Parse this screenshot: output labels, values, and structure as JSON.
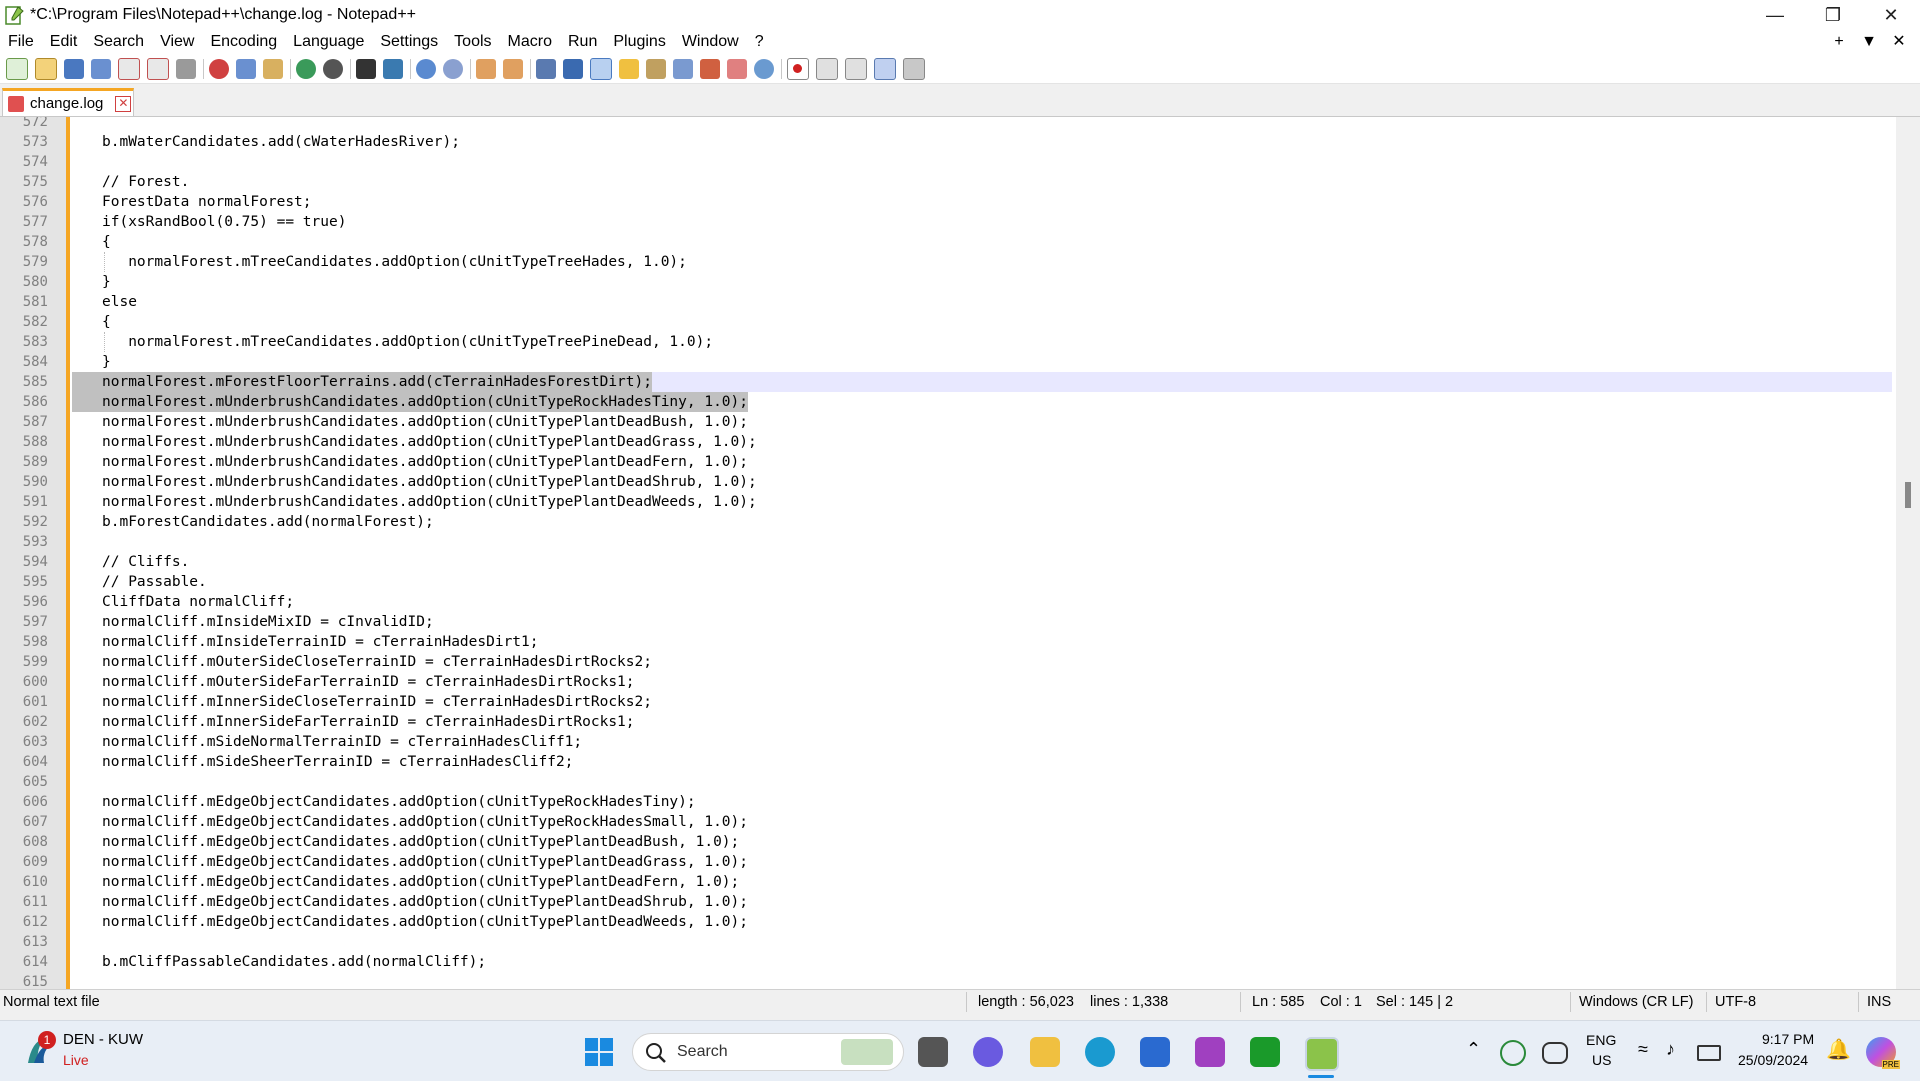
{
  "window": {
    "title": "*C:\\Program Files\\Notepad++\\change.log - Notepad++",
    "min_icon": "minimize-icon",
    "max_icon": "restore-icon",
    "close_icon": "close-icon"
  },
  "menu": {
    "items": [
      "File",
      "Edit",
      "Search",
      "View",
      "Encoding",
      "Language",
      "Settings",
      "Tools",
      "Macro",
      "Run",
      "Plugins",
      "Window",
      "?"
    ],
    "right": [
      "+",
      "▼",
      "✕"
    ]
  },
  "tab": {
    "label": "change.log",
    "close": "✕"
  },
  "editor": {
    "lines": [
      {
        "n": "572",
        "t": ""
      },
      {
        "n": "573",
        "t": "b.mWaterCandidates.add(cWaterHadesRiver);"
      },
      {
        "n": "574",
        "t": ""
      },
      {
        "n": "575",
        "t": "// Forest."
      },
      {
        "n": "576",
        "t": "ForestData normalForest;"
      },
      {
        "n": "577",
        "t": "if(xsRandBool(0.75) == true)"
      },
      {
        "n": "578",
        "t": "{"
      },
      {
        "n": "579",
        "t": "   normalForest.mTreeCandidates.addOption(cUnitTypeTreeHades, 1.0);"
      },
      {
        "n": "580",
        "t": "}"
      },
      {
        "n": "581",
        "t": "else"
      },
      {
        "n": "582",
        "t": "{"
      },
      {
        "n": "583",
        "t": "   normalForest.mTreeCandidates.addOption(cUnitTypeTreePineDead, 1.0);"
      },
      {
        "n": "584",
        "t": "}"
      },
      {
        "n": "585",
        "t": "normalForest.mForestFloorTerrains.add(cTerrainHadesForestDirt);"
      },
      {
        "n": "586",
        "t": "normalForest.mUnderbrushCandidates.addOption(cUnitTypeRockHadesTiny, 1.0);"
      },
      {
        "n": "587",
        "t": "normalForest.mUnderbrushCandidates.addOption(cUnitTypePlantDeadBush, 1.0);"
      },
      {
        "n": "588",
        "t": "normalForest.mUnderbrushCandidates.addOption(cUnitTypePlantDeadGrass, 1.0);"
      },
      {
        "n": "589",
        "t": "normalForest.mUnderbrushCandidates.addOption(cUnitTypePlantDeadFern, 1.0);"
      },
      {
        "n": "590",
        "t": "normalForest.mUnderbrushCandidates.addOption(cUnitTypePlantDeadShrub, 1.0);"
      },
      {
        "n": "591",
        "t": "normalForest.mUnderbrushCandidates.addOption(cUnitTypePlantDeadWeeds, 1.0);"
      },
      {
        "n": "592",
        "t": "b.mForestCandidates.add(normalForest);"
      },
      {
        "n": "593",
        "t": ""
      },
      {
        "n": "594",
        "t": "// Cliffs."
      },
      {
        "n": "595",
        "t": "// Passable."
      },
      {
        "n": "596",
        "t": "CliffData normalCliff;"
      },
      {
        "n": "597",
        "t": "normalCliff.mInsideMixID = cInvalidID;"
      },
      {
        "n": "598",
        "t": "normalCliff.mInsideTerrainID = cTerrainHadesDirt1;"
      },
      {
        "n": "599",
        "t": "normalCliff.mOuterSideCloseTerrainID = cTerrainHadesDirtRocks2;"
      },
      {
        "n": "600",
        "t": "normalCliff.mOuterSideFarTerrainID = cTerrainHadesDirtRocks1;"
      },
      {
        "n": "601",
        "t": "normalCliff.mInnerSideCloseTerrainID = cTerrainHadesDirtRocks2;"
      },
      {
        "n": "602",
        "t": "normalCliff.mInnerSideFarTerrainID = cTerrainHadesDirtRocks1;"
      },
      {
        "n": "603",
        "t": "normalCliff.mSideNormalTerrainID = cTerrainHadesCliff1;"
      },
      {
        "n": "604",
        "t": "normalCliff.mSideSheerTerrainID = cTerrainHadesCliff2;"
      },
      {
        "n": "605",
        "t": ""
      },
      {
        "n": "606",
        "t": "normalCliff.mEdgeObjectCandidates.addOption(cUnitTypeRockHadesTiny);"
      },
      {
        "n": "607",
        "t": "normalCliff.mEdgeObjectCandidates.addOption(cUnitTypeRockHadesSmall, 1.0);"
      },
      {
        "n": "608",
        "t": "normalCliff.mEdgeObjectCandidates.addOption(cUnitTypePlantDeadBush, 1.0);"
      },
      {
        "n": "609",
        "t": "normalCliff.mEdgeObjectCandidates.addOption(cUnitTypePlantDeadGrass, 1.0);"
      },
      {
        "n": "610",
        "t": "normalCliff.mEdgeObjectCandidates.addOption(cUnitTypePlantDeadFern, 1.0);"
      },
      {
        "n": "611",
        "t": "normalCliff.mEdgeObjectCandidates.addOption(cUnitTypePlantDeadShrub, 1.0);"
      },
      {
        "n": "612",
        "t": "normalCliff.mEdgeObjectCandidates.addOption(cUnitTypePlantDeadWeeds, 1.0);"
      },
      {
        "n": "613",
        "t": ""
      },
      {
        "n": "614",
        "t": "b.mCliffPassableCandidates.add(normalCliff);"
      },
      {
        "n": "615",
        "t": ""
      }
    ]
  },
  "status": {
    "file_type": "Normal text file",
    "length": "length : 56,023",
    "lines": "lines : 1,338",
    "ln": "Ln : 585",
    "col": "Col : 1",
    "sel": "Sel : 145 | 2",
    "eol": "Windows (CR LF)",
    "encoding": "UTF-8",
    "mode": "INS"
  },
  "taskbar": {
    "weather_title": "DEN - KUW",
    "weather_sub": "Live",
    "badge": "1",
    "search_placeholder": "Search",
    "lang1": "ENG",
    "lang2": "US",
    "time": "9:17 PM",
    "date": "25/09/2024",
    "pre_badge": "PRE"
  },
  "colors": {
    "accent": "#f5a623",
    "selection": "#c0c0c0",
    "current_line": "#e8e8ff",
    "gutter": "#e4e4e4"
  }
}
